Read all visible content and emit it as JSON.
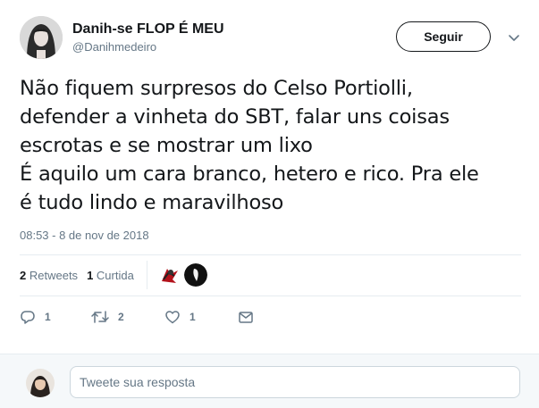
{
  "header": {
    "display_name": "Danih-se FLOP É MEU",
    "handle": "@Danihmedeiro",
    "follow_label": "Seguir"
  },
  "tweet": {
    "text": "Não fiquem surpresos do Celso Portiolli,\ndefender a vinheta do SBT, falar uns coisas\nescrotas e se mostrar um lixo\nÉ aquilo um cara branco, hetero e rico. Pra ele\né tudo lindo e maravilhoso",
    "timestamp": "08:53 - 8 de nov de 2018"
  },
  "stats": {
    "retweets_count": "2",
    "retweets_label": "Retweets",
    "likes_count": "1",
    "likes_label": "Curtida"
  },
  "actions": {
    "reply_count": "1",
    "retweet_count": "2",
    "like_count": "1"
  },
  "reply_box": {
    "placeholder": "Tweete sua resposta"
  },
  "icons": {
    "caret": "chevron-down-icon",
    "reply": "reply-icon",
    "retweet": "retweet-icon",
    "like": "heart-icon",
    "dm": "envelope-icon"
  },
  "colors": {
    "text": "#14171a",
    "secondary": "#657786",
    "divider": "#e6ecf0",
    "reply_bg": "#f5f8fa"
  }
}
